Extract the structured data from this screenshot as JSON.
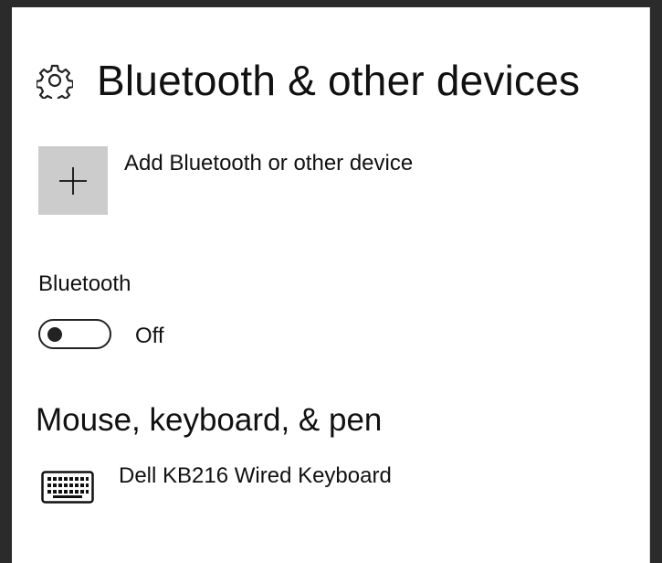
{
  "header": {
    "icon": "gear-icon",
    "title": "Bluetooth & other devices"
  },
  "add_device": {
    "icon": "plus-icon",
    "label": "Add Bluetooth or other device"
  },
  "bluetooth": {
    "label": "Bluetooth",
    "toggle_state": "Off",
    "enabled": false
  },
  "sections": {
    "mouse_keyboard_pen": {
      "heading": "Mouse, keyboard, & pen",
      "devices": [
        {
          "icon": "keyboard-icon",
          "name": "Dell KB216 Wired Keyboard"
        }
      ]
    }
  }
}
